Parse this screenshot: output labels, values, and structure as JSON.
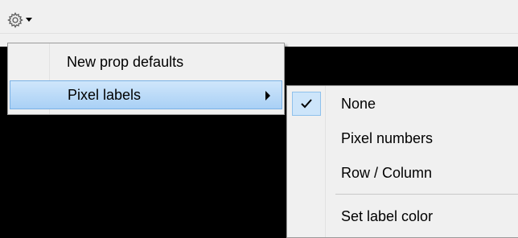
{
  "toolbar": {
    "gear_icon": "gear-icon",
    "dropdown_icon": "caret-down-icon"
  },
  "context_menu": {
    "items": [
      {
        "label": "New prop defaults",
        "has_submenu": false,
        "highlighted": false
      },
      {
        "label": "Pixel labels",
        "has_submenu": true,
        "highlighted": true
      }
    ]
  },
  "pixel_labels_submenu": {
    "items": [
      {
        "label": "None",
        "checked": true
      },
      {
        "label": "Pixel numbers",
        "checked": false
      },
      {
        "label": "Row / Column",
        "checked": false
      },
      {
        "label": "Set label color",
        "checked": false
      }
    ]
  },
  "colors": {
    "menu_bg": "#f0f0f0",
    "highlight_bg": "#a9d0f5",
    "highlight_border": "#7ab1e6",
    "canvas_bg": "#000000"
  }
}
